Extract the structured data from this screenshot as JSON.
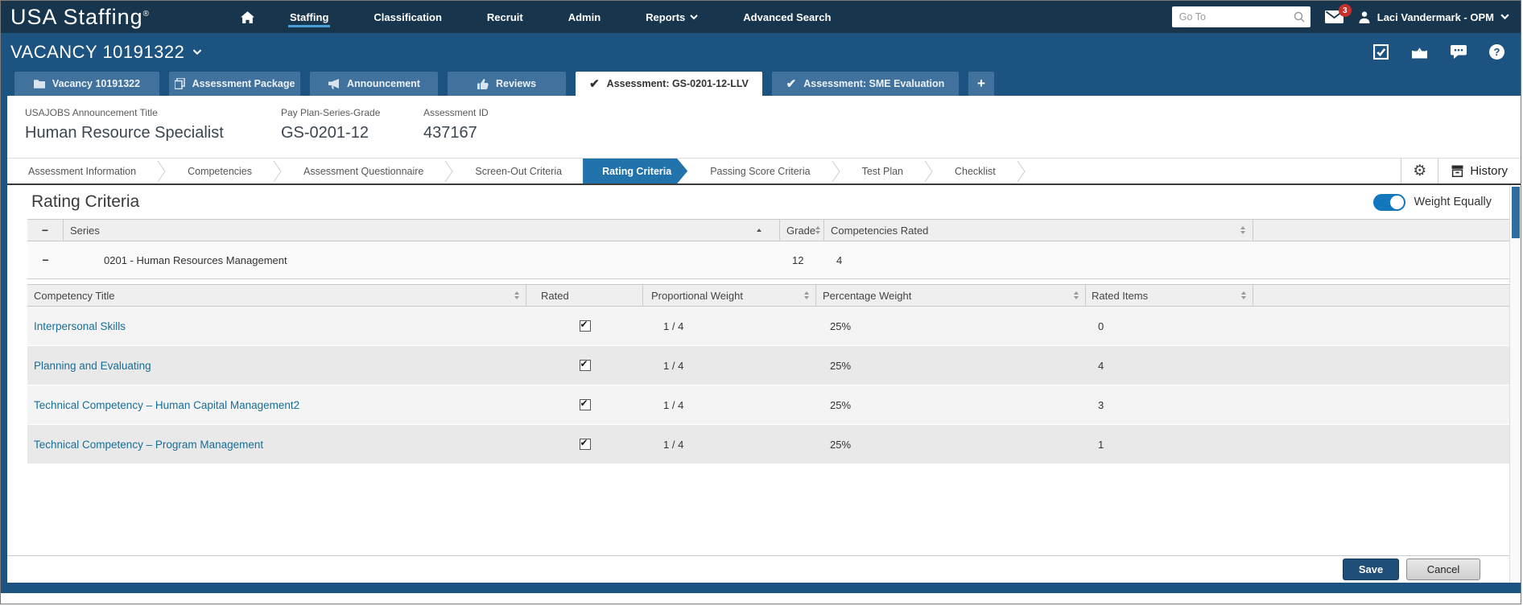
{
  "topbar": {
    "logo": "USA Staffing",
    "logo_reg": "®",
    "nav": [
      {
        "label": "Staffing",
        "active": true
      },
      {
        "label": "Classification",
        "active": false
      },
      {
        "label": "Recruit",
        "active": false
      },
      {
        "label": "Admin",
        "active": false
      },
      {
        "label": "Reports",
        "active": false,
        "has_dropdown": true
      },
      {
        "label": "Advanced Search",
        "active": false
      }
    ],
    "goto_placeholder": "Go To",
    "messages_badge": "3",
    "user": "Laci Vandermark - OPM"
  },
  "vacancy": {
    "title": "VACANCY 10191322"
  },
  "tabs": [
    {
      "label": "Vacancy 10191322",
      "icon": "folder-icon",
      "active": false
    },
    {
      "label": "Assessment Package",
      "icon": "copy-icon",
      "active": false
    },
    {
      "label": "Announcement",
      "icon": "megaphone-icon",
      "active": false
    },
    {
      "label": "Reviews",
      "icon": "thumbs-up-icon",
      "active": false
    },
    {
      "label": "Assessment: GS-0201-12-LLV",
      "icon": "check-icon",
      "active": true
    },
    {
      "label": "Assessment: SME Evaluation",
      "icon": "check-icon",
      "active": false
    },
    {
      "label": "+",
      "icon": "plus-icon",
      "active": false
    }
  ],
  "info": {
    "announcement_title_label": "USAJOBS Announcement Title",
    "announcement_title": "Human Resource Specialist",
    "pay_plan_label": "Pay Plan-Series-Grade",
    "pay_plan": "GS-0201-12",
    "assessment_id_label": "Assessment ID",
    "assessment_id": "437167"
  },
  "wizard": {
    "steps": [
      {
        "label": "Assessment Information",
        "active": false
      },
      {
        "label": "Competencies",
        "active": false
      },
      {
        "label": "Assessment Questionnaire",
        "active": false
      },
      {
        "label": "Screen-Out Criteria",
        "active": false
      },
      {
        "label": "Rating Criteria",
        "active": true
      },
      {
        "label": "Passing Score Criteria",
        "active": false
      },
      {
        "label": "Test Plan",
        "active": false
      },
      {
        "label": "Checklist",
        "active": false
      }
    ],
    "history_label": "History"
  },
  "section": {
    "title": "Rating Criteria",
    "toggle_label": "Weight Equally",
    "toggle_on": true
  },
  "series_table": {
    "columns": {
      "series": "Series",
      "grade": "Grade",
      "competencies_rated": "Competencies Rated"
    },
    "sort": {
      "series": "asc"
    },
    "row": {
      "series": "0201 - Human Resources Management",
      "grade": "12",
      "competencies_rated": "4"
    }
  },
  "competency_table": {
    "columns": {
      "title": "Competency Title",
      "rated": "Rated",
      "proportional_weight": "Proportional Weight",
      "percentage_weight": "Percentage Weight",
      "rated_items": "Rated Items"
    },
    "rows": [
      {
        "title": "Interpersonal Skills",
        "rated": true,
        "proportional_weight": "1 / 4",
        "percentage_weight": "25%",
        "rated_items": "0"
      },
      {
        "title": "Planning and Evaluating",
        "rated": true,
        "proportional_weight": "1 / 4",
        "percentage_weight": "25%",
        "rated_items": "4"
      },
      {
        "title": "Technical Competency – Human Capital Management2",
        "rated": true,
        "proportional_weight": "1 / 4",
        "percentage_weight": "25%",
        "rated_items": "3"
      },
      {
        "title": "Technical Competency – Program Management",
        "rated": true,
        "proportional_weight": "1 / 4",
        "percentage_weight": "25%",
        "rated_items": "1"
      }
    ]
  },
  "footer": {
    "save_label": "Save",
    "cancel_label": "Cancel"
  },
  "icons": {
    "home-icon": "house",
    "search-icon": "magnifier",
    "messages-icon": "envelope with badge",
    "user-icon": "person silhouette",
    "chevron-down-icon": "⌄",
    "tasks-icon": "checked box",
    "envelope-open-icon": "open envelope",
    "chat-icon": "speech bubble with dots",
    "help-icon": "? in circle",
    "folder-icon": "folder",
    "copy-icon": "stacked pages",
    "megaphone-icon": "megaphone",
    "thumbs-up-icon": "thumb up",
    "check-icon": "✓",
    "plus-icon": "+",
    "gear-icon": "⚙",
    "history-icon": "archive box",
    "sort-icon": "▲▼ stacked triangles",
    "collapse-icon": "−"
  },
  "colors": {
    "topbar_bg": "#17364e",
    "band_bg": "#1d5380",
    "tab_inactive_bg": "#41719d",
    "nav_underline": "#4aa1d9",
    "active_step_bg": "#2272ab",
    "toggle_on": "#1377bd",
    "link": "#176e96",
    "badge_red": "#c62f2a",
    "save_bg": "#1f4e79",
    "header_row_bg": "#efeff0"
  }
}
